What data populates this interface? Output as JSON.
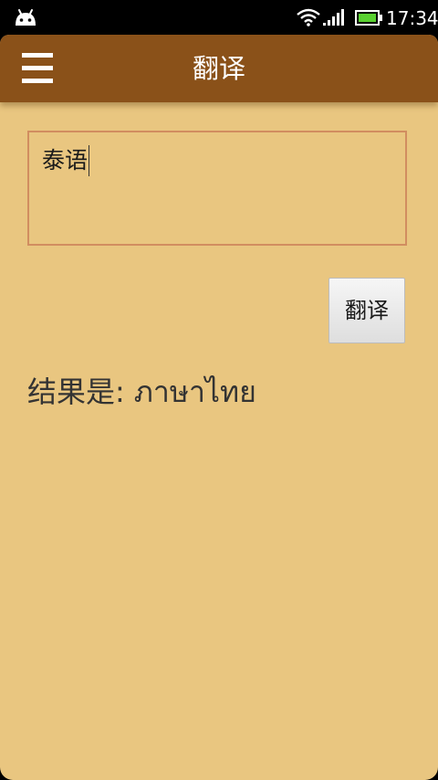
{
  "status_bar": {
    "time": "17:34"
  },
  "action_bar": {
    "title": "翻译"
  },
  "input": {
    "value": "泰语"
  },
  "translate_button": {
    "label": "翻译"
  },
  "result": {
    "label": "结果是:",
    "value": "ภาษาไทย"
  },
  "colors": {
    "action_bar": "#8a5119",
    "background": "#e9c680",
    "input_border": "#d18d60"
  }
}
